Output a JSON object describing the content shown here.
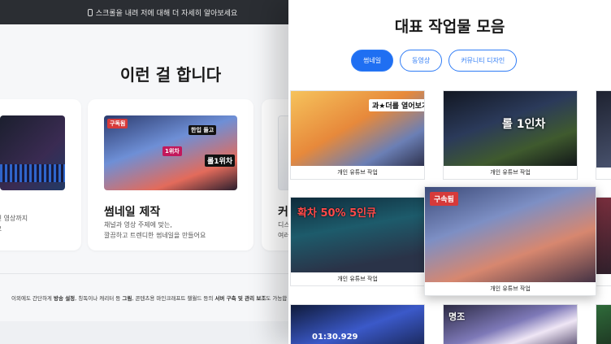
{
  "topbar": {
    "text": "스크롤을 내려 저에 대해 더 자세히 알아보세요",
    "icon": "mouse-icon"
  },
  "services": {
    "title": "이런 걸 합니다",
    "cards": [
      {
        "title": "",
        "desc_lines": [
          "화하신 영상까지",
          "능해요"
        ]
      },
      {
        "title": "썸네일 제작",
        "desc_lines": [
          "채널과 영상 주제에 맞는,",
          "깔끔하고 트렌디한 썸네일을 만들어요"
        ],
        "thumb_texts": [
          "구독됨",
          "한입 들고",
          "1위차",
          "롤1위차"
        ]
      },
      {
        "title": "커뮤니",
        "desc_lines": [
          "디스코",
          "여러 커뮤니티"
        ]
      }
    ]
  },
  "footnote": {
    "pre": "이외에도 간단하게 ",
    "bold1": "방송 설정",
    "mid1": ", 칭독이나 캐리터 등 ",
    "bold2": "그림",
    "mid2": ", 콘텐츠용 마인크래프트 챌월드 등의 ",
    "bold3": "서버 구축 및 관리 보조",
    "post": "도 가능합"
  },
  "portfolio": {
    "title": "대표 작업물 모음",
    "tabs": [
      {
        "label": "썸네일",
        "active": true
      },
      {
        "label": "동영상",
        "active": false
      },
      {
        "label": "커뮤니티 디자인",
        "active": false
      }
    ],
    "tiles": [
      {
        "caption": "개인 유튜브 작업",
        "overlay": "과★더를 열어보가!"
      },
      {
        "caption": "개인 유튜브 작업",
        "overlay": "롤 1인차"
      },
      {
        "caption": "",
        "overlay": ""
      },
      {
        "caption": "개인 유튜브 작업",
        "overlay": "확차 50% 5인큐"
      },
      {
        "caption": "개인 유튜브 작업",
        "overlay": "구속됨"
      },
      {
        "caption": "",
        "overlay": ""
      },
      {
        "caption": "",
        "overlay": "01:30.929"
      },
      {
        "caption": "",
        "overlay": "명조"
      },
      {
        "caption": "",
        "overlay": ""
      }
    ]
  },
  "colors": {
    "accent": "#1f6ff2",
    "topbar": "#2b2e33",
    "badge": "#d63a3a"
  }
}
